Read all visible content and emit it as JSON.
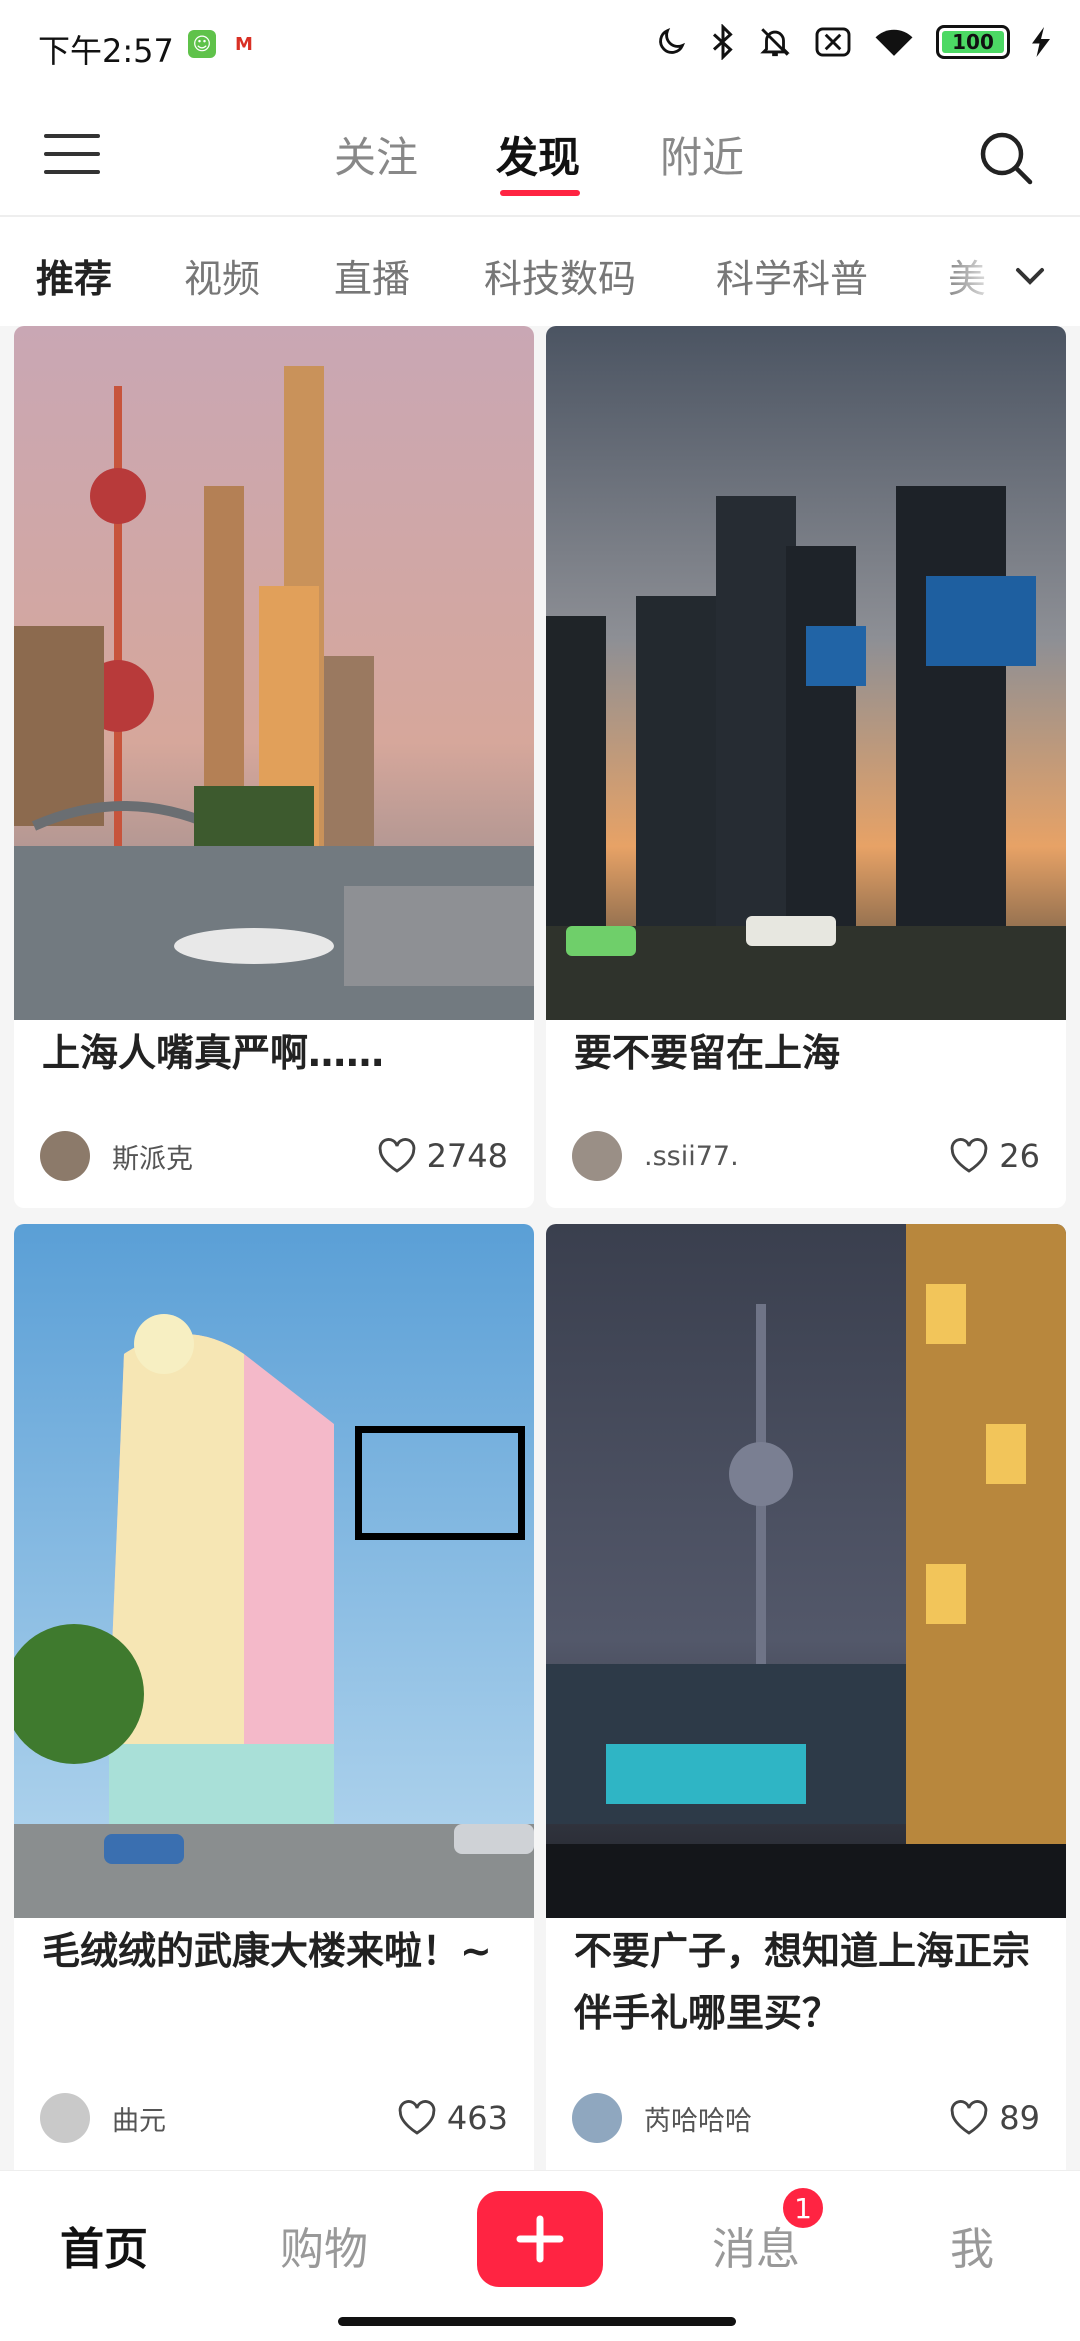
{
  "status_bar": {
    "time": "下午2:57",
    "battery": "100"
  },
  "top_nav": {
    "tabs": [
      {
        "label": "关注"
      },
      {
        "label": "发现"
      },
      {
        "label": "附近"
      }
    ],
    "active_tab": "发现"
  },
  "categories": [
    {
      "label": "推荐"
    },
    {
      "label": "视频"
    },
    {
      "label": "直播"
    },
    {
      "label": "科技数码"
    },
    {
      "label": "科学科普"
    },
    {
      "label": "美"
    }
  ],
  "feed": {
    "cards": [
      {
        "title": "上海人嘴真严啊……",
        "author": "斯派克",
        "likes": "2748"
      },
      {
        "title": "要不要留在上海",
        "author": ".ssii77.",
        "likes": "26"
      },
      {
        "title": "毛绒绒的武康大楼来啦！~",
        "author": "曲元",
        "likes": "463"
      },
      {
        "title": "不要广子，想知道上海正宗伴手礼哪里买？",
        "author": "芮哈哈哈",
        "likes": "89"
      }
    ]
  },
  "bottom_nav": {
    "items": [
      {
        "label": "首页"
      },
      {
        "label": "购物"
      },
      {
        "label": "消息"
      },
      {
        "label": "我"
      }
    ],
    "message_badge": "1",
    "accent_color": "#ff2442"
  }
}
